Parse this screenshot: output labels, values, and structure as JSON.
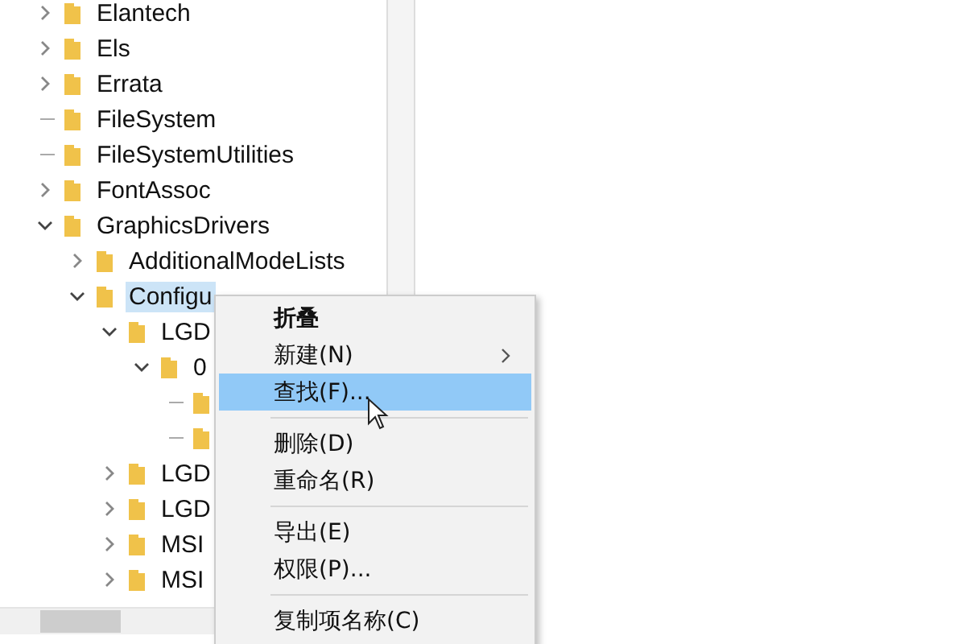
{
  "tree": [
    {
      "label": "Elantech",
      "kind": "branch",
      "expanded": false,
      "selected": false
    },
    {
      "label": "Els",
      "kind": "branch",
      "expanded": false,
      "selected": false
    },
    {
      "label": "Errata",
      "kind": "branch",
      "expanded": false,
      "selected": false
    },
    {
      "label": "FileSystem",
      "kind": "leaf",
      "selected": false
    },
    {
      "label": "FileSystemUtilities",
      "kind": "leaf",
      "selected": false
    },
    {
      "label": "FontAssoc",
      "kind": "branch",
      "expanded": false,
      "selected": false
    },
    {
      "label": "GraphicsDrivers",
      "kind": "branch",
      "expanded": true,
      "selected": false,
      "children": [
        {
          "label": "AdditionalModeLists",
          "kind": "branch",
          "expanded": false,
          "selected": false
        },
        {
          "label": "Configu",
          "kind": "branch",
          "expanded": true,
          "selected": true,
          "children": [
            {
              "label": "LGD",
              "kind": "branch",
              "expanded": true,
              "selected": false,
              "children": [
                {
                  "label": "0",
                  "kind": "branch",
                  "expanded": true,
                  "selected": false,
                  "children": [
                    {
                      "kind": "leaf",
                      "selected": false
                    },
                    {
                      "kind": "leaf",
                      "selected": false
                    }
                  ]
                }
              ]
            },
            {
              "label": "LGD",
              "kind": "branch",
              "expanded": false,
              "selected": false
            },
            {
              "label": "LGD",
              "kind": "branch",
              "expanded": false,
              "selected": false
            },
            {
              "label": "MSI",
              "kind": "branch",
              "expanded": false,
              "selected": false
            },
            {
              "label": "MSI",
              "kind": "branch",
              "expanded": false,
              "selected": false
            }
          ]
        }
      ]
    }
  ],
  "context_menu": [
    {
      "kind": "item",
      "label": "折叠",
      "default": true,
      "selected": false
    },
    {
      "kind": "item",
      "label": "新建(N)",
      "default": false,
      "submenu": true,
      "selected": false
    },
    {
      "kind": "item",
      "label": "查找(F)...",
      "default": false,
      "selected": true
    },
    {
      "kind": "separator"
    },
    {
      "kind": "item",
      "label": "删除(D)",
      "default": false,
      "selected": false
    },
    {
      "kind": "item",
      "label": "重命名(R)",
      "default": false,
      "selected": false
    },
    {
      "kind": "separator"
    },
    {
      "kind": "item",
      "label": "导出(E)",
      "default": false,
      "selected": false
    },
    {
      "kind": "item",
      "label": "权限(P)...",
      "default": false,
      "selected": false
    },
    {
      "kind": "separator"
    },
    {
      "kind": "item",
      "label": "复制项名称(C)",
      "default": false,
      "selected": false
    }
  ]
}
